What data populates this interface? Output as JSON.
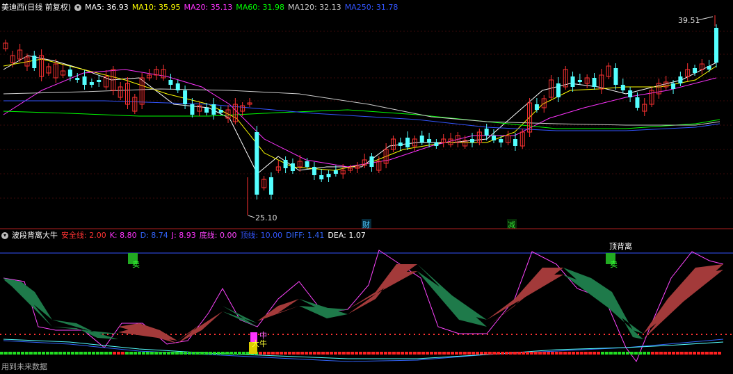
{
  "main_panel": {
    "stock_title": "美迪西(日线 前复权)",
    "ma_items": [
      {
        "label": "MA5: 36.93",
        "color": "#ffffff"
      },
      {
        "label": "MA10: 35.95",
        "color": "#ffff00"
      },
      {
        "label": "MA20: 35.13",
        "color": "#ff33ff"
      },
      {
        "label": "MA60: 31.98",
        "color": "#00ff00"
      },
      {
        "label": "MA120: 32.13",
        "color": "#cccccc"
      },
      {
        "label": "MA250: 31.78",
        "color": "#3355ff"
      }
    ],
    "high_label": "39.51",
    "low_label": "25.10",
    "markers": [
      {
        "label": "财",
        "color": "#4ec9ff"
      },
      {
        "label": "减",
        "color": "#33dd33"
      }
    ]
  },
  "indicator_panel": {
    "name": "波段背离大牛",
    "items": [
      {
        "label": "安全线: 2.00",
        "color": "#ff3333"
      },
      {
        "label": "K: 8.80",
        "color": "#ff33ff"
      },
      {
        "label": "D: 8.74",
        "color": "#3366ff"
      },
      {
        "label": "J: 8.93",
        "color": "#ff33ff"
      },
      {
        "label": "底线: 0.00",
        "color": "#ff44ff"
      },
      {
        "label": "顶线: 10.00",
        "color": "#3355ff"
      },
      {
        "label": "DIFF: 1.41",
        "color": "#3366ff"
      },
      {
        "label": "DEA: 1.07",
        "color": "#ffffff"
      }
    ],
    "signals": {
      "sell": "卖",
      "top_divergence": "顶背离",
      "medium": "中",
      "bull": "大牛"
    }
  },
  "footer": {
    "note": "用到未来数据"
  },
  "colors": {
    "up": "#ff3232",
    "down": "#54ffff",
    "background": "#000000"
  }
}
